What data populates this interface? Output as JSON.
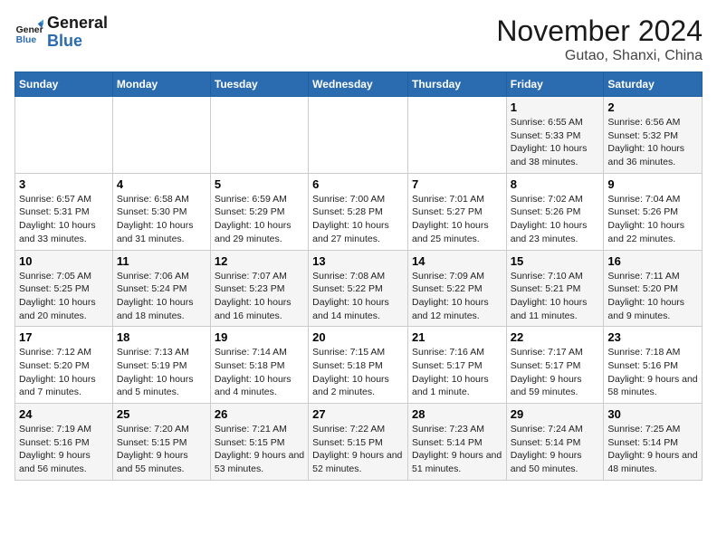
{
  "logo": {
    "line1": "General",
    "line2": "Blue"
  },
  "title": "November 2024",
  "location": "Gutao, Shanxi, China",
  "days_of_week": [
    "Sunday",
    "Monday",
    "Tuesday",
    "Wednesday",
    "Thursday",
    "Friday",
    "Saturday"
  ],
  "weeks": [
    [
      {
        "day": "",
        "info": ""
      },
      {
        "day": "",
        "info": ""
      },
      {
        "day": "",
        "info": ""
      },
      {
        "day": "",
        "info": ""
      },
      {
        "day": "",
        "info": ""
      },
      {
        "day": "1",
        "info": "Sunrise: 6:55 AM\nSunset: 5:33 PM\nDaylight: 10 hours and 38 minutes."
      },
      {
        "day": "2",
        "info": "Sunrise: 6:56 AM\nSunset: 5:32 PM\nDaylight: 10 hours and 36 minutes."
      }
    ],
    [
      {
        "day": "3",
        "info": "Sunrise: 6:57 AM\nSunset: 5:31 PM\nDaylight: 10 hours and 33 minutes."
      },
      {
        "day": "4",
        "info": "Sunrise: 6:58 AM\nSunset: 5:30 PM\nDaylight: 10 hours and 31 minutes."
      },
      {
        "day": "5",
        "info": "Sunrise: 6:59 AM\nSunset: 5:29 PM\nDaylight: 10 hours and 29 minutes."
      },
      {
        "day": "6",
        "info": "Sunrise: 7:00 AM\nSunset: 5:28 PM\nDaylight: 10 hours and 27 minutes."
      },
      {
        "day": "7",
        "info": "Sunrise: 7:01 AM\nSunset: 5:27 PM\nDaylight: 10 hours and 25 minutes."
      },
      {
        "day": "8",
        "info": "Sunrise: 7:02 AM\nSunset: 5:26 PM\nDaylight: 10 hours and 23 minutes."
      },
      {
        "day": "9",
        "info": "Sunrise: 7:04 AM\nSunset: 5:26 PM\nDaylight: 10 hours and 22 minutes."
      }
    ],
    [
      {
        "day": "10",
        "info": "Sunrise: 7:05 AM\nSunset: 5:25 PM\nDaylight: 10 hours and 20 minutes."
      },
      {
        "day": "11",
        "info": "Sunrise: 7:06 AM\nSunset: 5:24 PM\nDaylight: 10 hours and 18 minutes."
      },
      {
        "day": "12",
        "info": "Sunrise: 7:07 AM\nSunset: 5:23 PM\nDaylight: 10 hours and 16 minutes."
      },
      {
        "day": "13",
        "info": "Sunrise: 7:08 AM\nSunset: 5:22 PM\nDaylight: 10 hours and 14 minutes."
      },
      {
        "day": "14",
        "info": "Sunrise: 7:09 AM\nSunset: 5:22 PM\nDaylight: 10 hours and 12 minutes."
      },
      {
        "day": "15",
        "info": "Sunrise: 7:10 AM\nSunset: 5:21 PM\nDaylight: 10 hours and 11 minutes."
      },
      {
        "day": "16",
        "info": "Sunrise: 7:11 AM\nSunset: 5:20 PM\nDaylight: 10 hours and 9 minutes."
      }
    ],
    [
      {
        "day": "17",
        "info": "Sunrise: 7:12 AM\nSunset: 5:20 PM\nDaylight: 10 hours and 7 minutes."
      },
      {
        "day": "18",
        "info": "Sunrise: 7:13 AM\nSunset: 5:19 PM\nDaylight: 10 hours and 5 minutes."
      },
      {
        "day": "19",
        "info": "Sunrise: 7:14 AM\nSunset: 5:18 PM\nDaylight: 10 hours and 4 minutes."
      },
      {
        "day": "20",
        "info": "Sunrise: 7:15 AM\nSunset: 5:18 PM\nDaylight: 10 hours and 2 minutes."
      },
      {
        "day": "21",
        "info": "Sunrise: 7:16 AM\nSunset: 5:17 PM\nDaylight: 10 hours and 1 minute."
      },
      {
        "day": "22",
        "info": "Sunrise: 7:17 AM\nSunset: 5:17 PM\nDaylight: 9 hours and 59 minutes."
      },
      {
        "day": "23",
        "info": "Sunrise: 7:18 AM\nSunset: 5:16 PM\nDaylight: 9 hours and 58 minutes."
      }
    ],
    [
      {
        "day": "24",
        "info": "Sunrise: 7:19 AM\nSunset: 5:16 PM\nDaylight: 9 hours and 56 minutes."
      },
      {
        "day": "25",
        "info": "Sunrise: 7:20 AM\nSunset: 5:15 PM\nDaylight: 9 hours and 55 minutes."
      },
      {
        "day": "26",
        "info": "Sunrise: 7:21 AM\nSunset: 5:15 PM\nDaylight: 9 hours and 53 minutes."
      },
      {
        "day": "27",
        "info": "Sunrise: 7:22 AM\nSunset: 5:15 PM\nDaylight: 9 hours and 52 minutes."
      },
      {
        "day": "28",
        "info": "Sunrise: 7:23 AM\nSunset: 5:14 PM\nDaylight: 9 hours and 51 minutes."
      },
      {
        "day": "29",
        "info": "Sunrise: 7:24 AM\nSunset: 5:14 PM\nDaylight: 9 hours and 50 minutes."
      },
      {
        "day": "30",
        "info": "Sunrise: 7:25 AM\nSunset: 5:14 PM\nDaylight: 9 hours and 48 minutes."
      }
    ]
  ]
}
